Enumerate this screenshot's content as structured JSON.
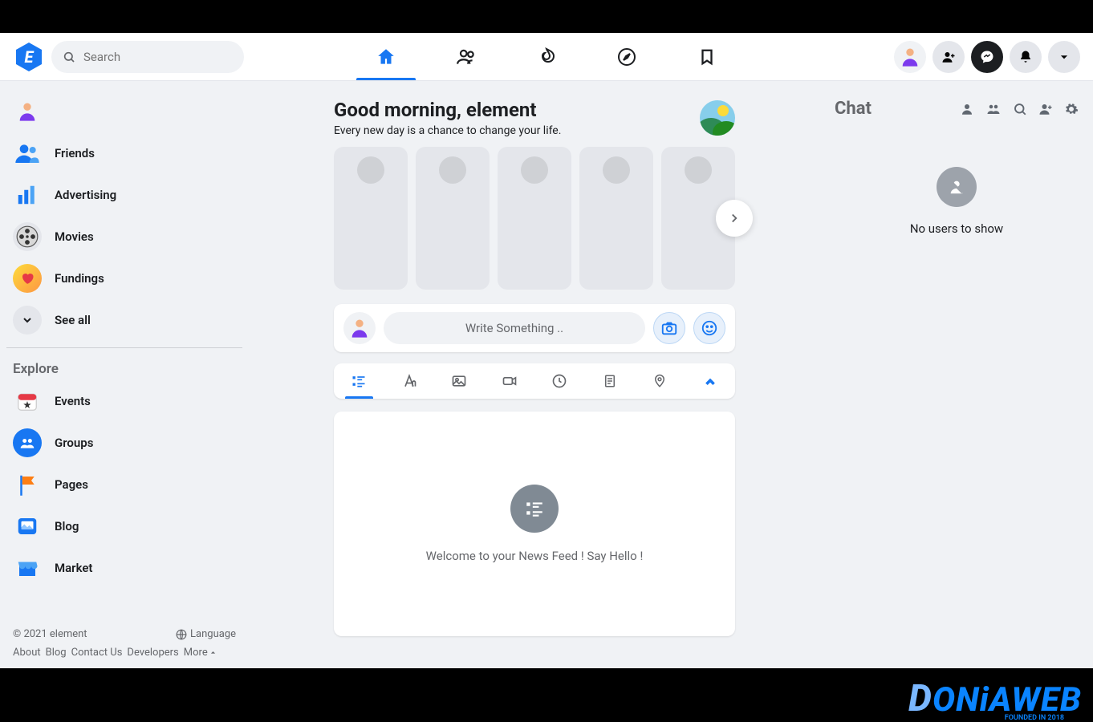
{
  "search": {
    "placeholder": "Search"
  },
  "sidebar": {
    "items": [
      {
        "label": ""
      },
      {
        "label": "Friends"
      },
      {
        "label": "Advertising"
      },
      {
        "label": "Movies"
      },
      {
        "label": "Fundings"
      },
      {
        "label": "See all"
      }
    ],
    "explore_title": "Explore",
    "explore": [
      {
        "label": "Events"
      },
      {
        "label": "Groups"
      },
      {
        "label": "Pages"
      },
      {
        "label": "Blog"
      },
      {
        "label": "Market"
      }
    ],
    "copyright": "© 2021 element",
    "language": "Language",
    "footer_links": [
      "About",
      "Blog",
      "Contact Us",
      "Developers",
      "More"
    ]
  },
  "greeting": {
    "title": "Good morning, element",
    "subtitle": "Every new day is a chance to change your life."
  },
  "composer": {
    "placeholder": "Write Something .."
  },
  "feed": {
    "empty_text": "Welcome to your News Feed ! Say Hello !"
  },
  "chat": {
    "title": "Chat",
    "empty_text": "No users to show"
  },
  "watermark": {
    "brand_d": "D",
    "brand_rest": "ONiAWEB",
    "founded": "FOUNDED IN 2018"
  }
}
